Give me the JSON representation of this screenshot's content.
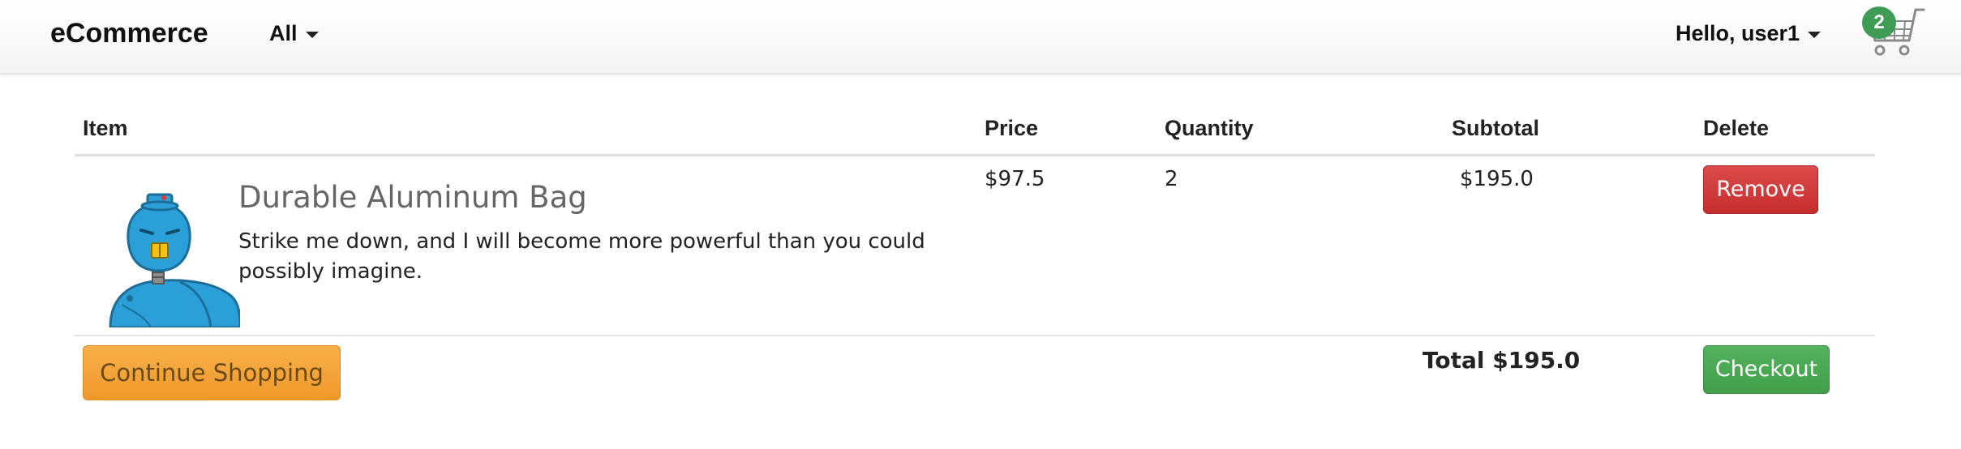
{
  "navbar": {
    "brand": "eCommerce",
    "category_label": "All",
    "user_label": "Hello, user1",
    "cart_count": "2"
  },
  "table": {
    "headers": {
      "item": "Item",
      "price": "Price",
      "quantity": "Quantity",
      "subtotal": "Subtotal",
      "delete": "Delete"
    },
    "rows": [
      {
        "name": "Durable Aluminum Bag",
        "description": "Strike me down, and I will become more powerful than you could possibly imagine.",
        "price": "$97.5",
        "quantity": "2",
        "subtotal": "$195.0",
        "remove_label": "Remove"
      }
    ]
  },
  "footer": {
    "continue_label": "Continue Shopping",
    "total": "Total $195.0",
    "checkout_label": "Checkout"
  },
  "icons": {
    "cart": "shopping-cart-icon",
    "dropdown": "caret-down-icon",
    "product_image": "robot-avatar"
  },
  "colors": {
    "remove": "#c9302c",
    "checkout": "#449d44",
    "continue": "#f0ad4e",
    "badge": "#3e9c55",
    "robot": "#2b9fd8"
  }
}
